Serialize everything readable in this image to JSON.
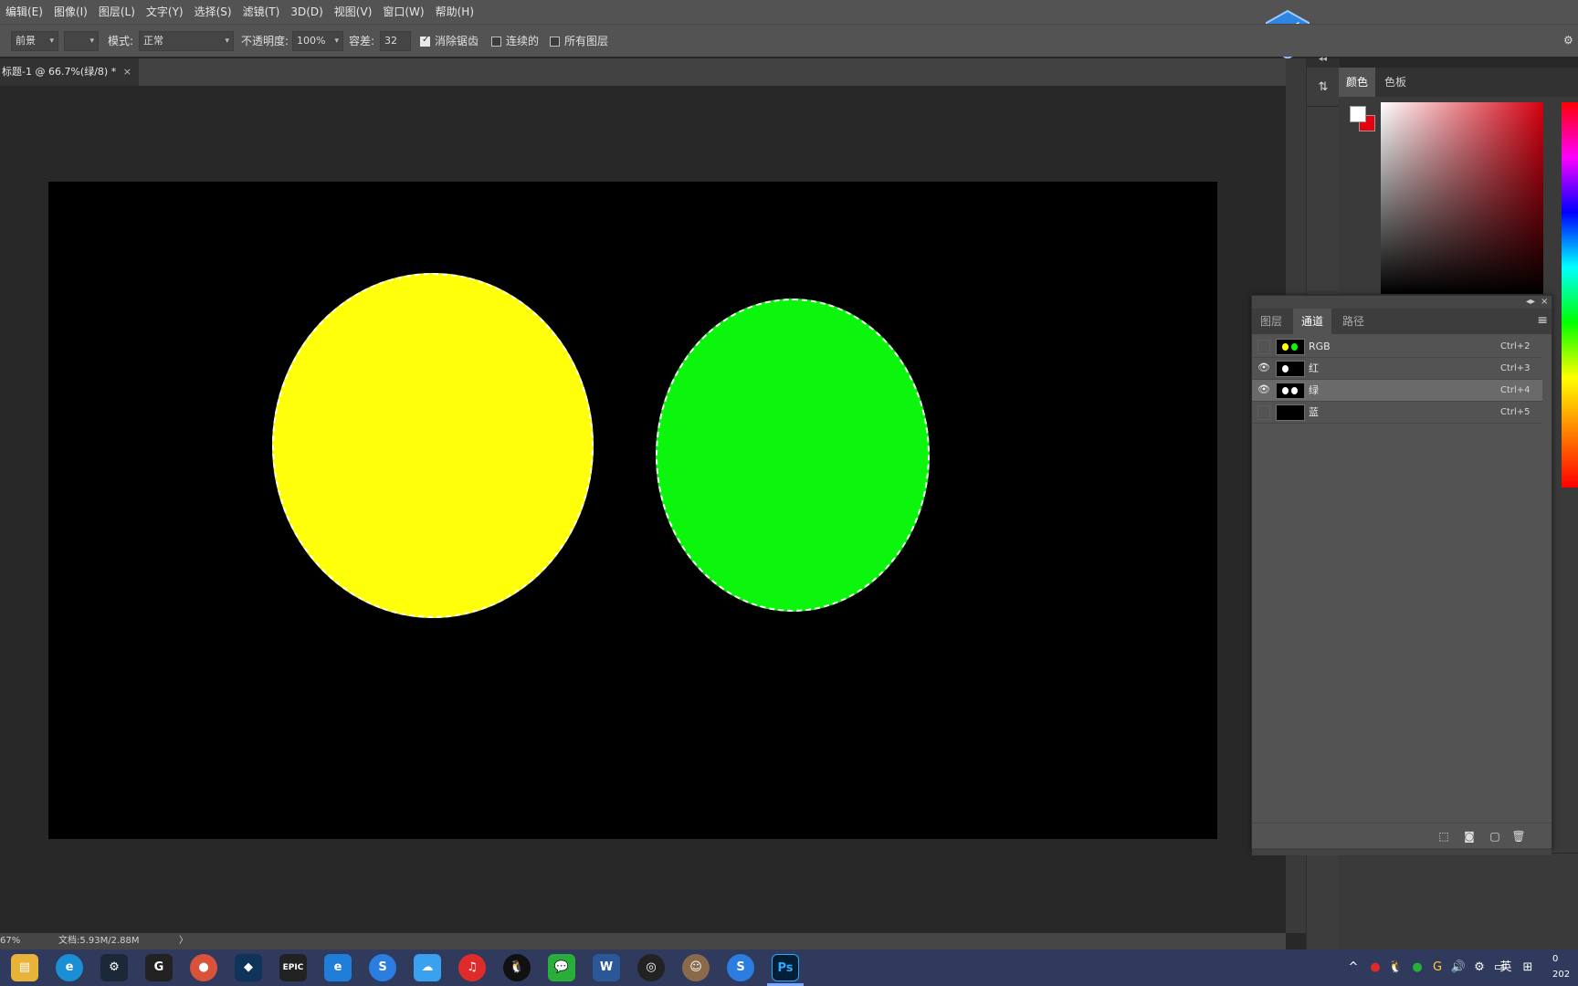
{
  "menu": [
    "编辑(E)",
    "图像(I)",
    "图层(L)",
    "文字(Y)",
    "选择(S)",
    "滤镜(T)",
    "3D(D)",
    "视图(V)",
    "窗口(W)",
    "帮助(H)"
  ],
  "options": {
    "fill_source": "前景",
    "mode_label": "模式:",
    "mode_value": "正常",
    "opacity_label": "不透明度:",
    "opacity_value": "100%",
    "tolerance_label": "容差:",
    "tolerance_value": "32",
    "antialias_label": "消除锯齿",
    "antialias_checked": true,
    "contiguous_label": "连续的",
    "contiguous_checked": false,
    "all_layers_label": "所有图层",
    "all_layers_checked": false
  },
  "document_tab": {
    "title": "标题-1 @ 66.7%(绿/8) *",
    "close": "×"
  },
  "canvas": {
    "background_color": "#000000",
    "yellow_color": "#ffff0a",
    "green_color": "#0cf50c"
  },
  "color_panel": {
    "tabs": [
      "颜色",
      "色板"
    ],
    "active_tab": 0,
    "foreground": "#ffffff",
    "background": "#e60010"
  },
  "channels_panel": {
    "tabs": [
      "图层",
      "通道",
      "路径"
    ],
    "active_tab": 1,
    "rows": [
      {
        "name": "RGB",
        "shortcut": "Ctrl+2",
        "visible": false,
        "selected": false
      },
      {
        "name": "红",
        "shortcut": "Ctrl+3",
        "visible": true,
        "selected": false
      },
      {
        "name": "绿",
        "shortcut": "Ctrl+4",
        "visible": true,
        "selected": true
      },
      {
        "name": "蓝",
        "shortcut": "Ctrl+5",
        "visible": false,
        "selected": false
      }
    ]
  },
  "status": {
    "zoom": "67%",
    "doc_info": "文档:5.93M/2.88M",
    "arrow": "〉"
  },
  "taskbar": {
    "apps": [
      "file-explorer",
      "edge",
      "steam",
      "g-app",
      "red-app",
      "blue-app",
      "epic-games",
      "blue-edge",
      "sogou",
      "cloud-app",
      "netease-music",
      "qq",
      "wechat",
      "word",
      "obs",
      "avatar-app",
      "sogou-2",
      "photoshop"
    ],
    "tray_lang": "英",
    "tray_clock_line1": "0",
    "tray_clock_line2": "202"
  }
}
